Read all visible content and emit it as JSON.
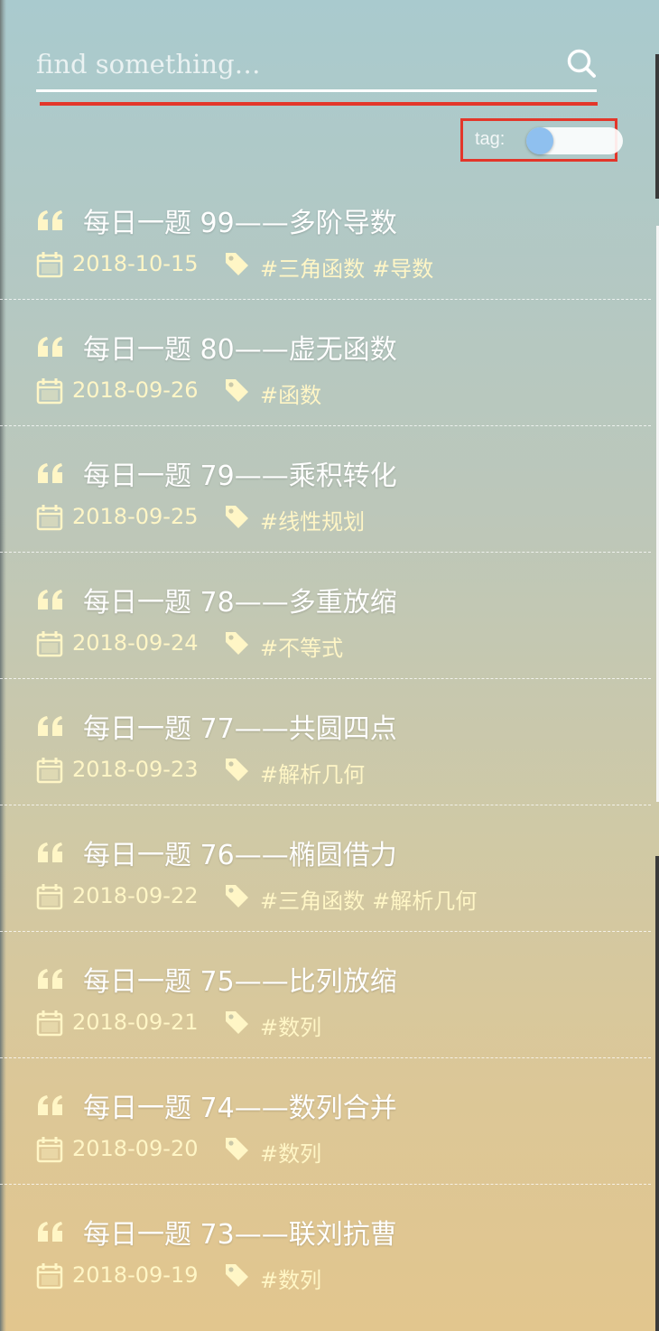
{
  "search": {
    "placeholder": "find something…",
    "value": ""
  },
  "tag_toggle": {
    "label": "tag:",
    "on": false
  },
  "colors": {
    "accent_red": "#e3362a",
    "meta_text": "#fff6c6",
    "toggle_knob": "#8fc0ef"
  },
  "icons": {
    "search": "search-icon",
    "quote": "quote-icon",
    "calendar": "calendar-icon",
    "tag": "tag-icon"
  },
  "posts": [
    {
      "title": "每日一题 99——多阶导数",
      "date": "2018-10-15",
      "tags": [
        "#三角函数",
        "#导数"
      ]
    },
    {
      "title": "每日一题 80——虚无函数",
      "date": "2018-09-26",
      "tags": [
        "#函数"
      ]
    },
    {
      "title": "每日一题 79——乘积转化",
      "date": "2018-09-25",
      "tags": [
        "#线性规划"
      ]
    },
    {
      "title": "每日一题 78——多重放缩",
      "date": "2018-09-24",
      "tags": [
        "#不等式"
      ]
    },
    {
      "title": "每日一题 77——共圆四点",
      "date": "2018-09-23",
      "tags": [
        "#解析几何"
      ]
    },
    {
      "title": "每日一题 76——椭圆借力",
      "date": "2018-09-22",
      "tags": [
        "#三角函数",
        "#解析几何"
      ]
    },
    {
      "title": "每日一题 75——比列放缩",
      "date": "2018-09-21",
      "tags": [
        "#数列"
      ]
    },
    {
      "title": "每日一题 74——数列合并",
      "date": "2018-09-20",
      "tags": [
        "#数列"
      ]
    },
    {
      "title": "每日一题 73——联刘抗曹",
      "date": "2018-09-19",
      "tags": [
        "#数列"
      ]
    }
  ]
}
